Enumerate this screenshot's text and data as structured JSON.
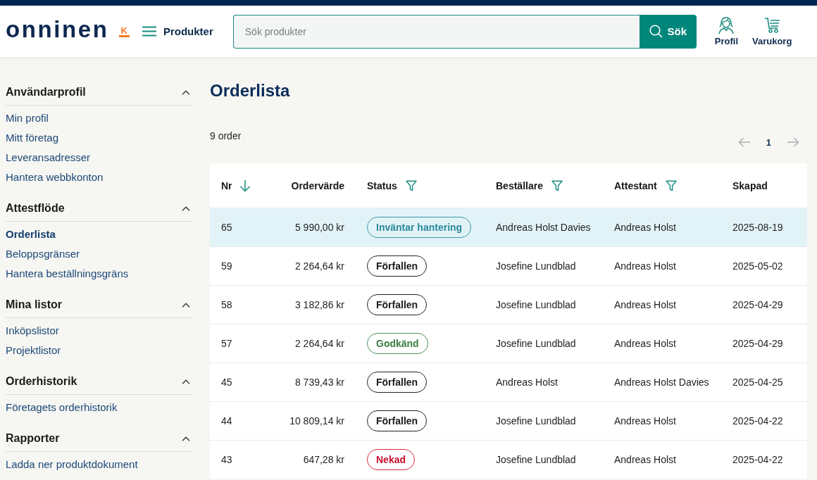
{
  "header": {
    "logo": {
      "wordmark": "onninen",
      "badge": "K"
    },
    "menu_button": {
      "label": "Produkter"
    },
    "search": {
      "placeholder": "Sök produkter",
      "button": "Sök"
    },
    "actions": [
      {
        "label": "Profil",
        "kind": "profile"
      },
      {
        "label": "Varukorg",
        "kind": "cart"
      }
    ]
  },
  "sidebar": {
    "sections": [
      {
        "title": "Användarprofil",
        "expanded": true,
        "items": [
          {
            "label": "Min profil",
            "selected": false
          },
          {
            "label": "Mitt företag",
            "selected": false
          },
          {
            "label": "Leveransadresser",
            "selected": false
          },
          {
            "label": "Hantera webbkonton",
            "selected": false
          }
        ]
      },
      {
        "title": "Attestflöde",
        "expanded": true,
        "items": [
          {
            "label": "Orderlista",
            "selected": true
          },
          {
            "label": "Beloppsgränser",
            "selected": false
          },
          {
            "label": "Hantera beställningsgräns",
            "selected": false
          }
        ]
      },
      {
        "title": "Mina listor",
        "expanded": true,
        "items": [
          {
            "label": "Inköpslistor",
            "selected": false
          },
          {
            "label": "Projektlistor",
            "selected": false
          }
        ]
      },
      {
        "title": "Orderhistorik",
        "expanded": true,
        "items": [
          {
            "label": "Företagets orderhistorik",
            "selected": false
          }
        ]
      },
      {
        "title": "Rapporter",
        "expanded": true,
        "items": [
          {
            "label": "Ladda ner produktdokument",
            "selected": false
          }
        ]
      }
    ]
  },
  "main": {
    "title": "Orderlista",
    "count": "9 order",
    "pagination": {
      "page": "1"
    },
    "table": {
      "columns": [
        {
          "label": "Nr",
          "sorted": true,
          "filter": false
        },
        {
          "label": "Ordervärde",
          "sorted": false,
          "filter": false
        },
        {
          "label": "Status",
          "sorted": false,
          "filter": true
        },
        {
          "label": "Beställare",
          "sorted": false,
          "filter": true
        },
        {
          "label": "Attestant",
          "sorted": false,
          "filter": true
        },
        {
          "label": "Skapad",
          "sorted": false,
          "filter": false
        }
      ],
      "rows": [
        {
          "nr": "65",
          "value": "5 990,00 kr",
          "status": {
            "label": "Inväntar hantering",
            "kind": "pending"
          },
          "orderer": "Andreas Holst Davies",
          "approver": "Andreas Holst",
          "created": "2025-08-19",
          "selected": true
        },
        {
          "nr": "59",
          "value": "2 264,64 kr",
          "status": {
            "label": "Förfallen",
            "kind": "overdue"
          },
          "orderer": "Josefine Lundblad",
          "approver": "Andreas Holst",
          "created": "2025-05-02",
          "selected": false
        },
        {
          "nr": "58",
          "value": "3 182,86 kr",
          "status": {
            "label": "Förfallen",
            "kind": "overdue"
          },
          "orderer": "Josefine Lundblad",
          "approver": "Andreas Holst",
          "created": "2025-04-29",
          "selected": false
        },
        {
          "nr": "57",
          "value": "2 264,64 kr",
          "status": {
            "label": "Godkänd",
            "kind": "approved"
          },
          "orderer": "Josefine Lundblad",
          "approver": "Andreas Holst",
          "created": "2025-04-29",
          "selected": false
        },
        {
          "nr": "45",
          "value": "8 739,43 kr",
          "status": {
            "label": "Förfallen",
            "kind": "overdue"
          },
          "orderer": "Andreas Holst",
          "approver": "Andreas Holst Davies",
          "created": "2025-04-25",
          "selected": false
        },
        {
          "nr": "44",
          "value": "10 809,14 kr",
          "status": {
            "label": "Förfallen",
            "kind": "overdue"
          },
          "orderer": "Josefine Lundblad",
          "approver": "Andreas Holst",
          "created": "2025-04-22",
          "selected": false
        },
        {
          "nr": "43",
          "value": "647,28 kr",
          "status": {
            "label": "Nekad",
            "kind": "rejected"
          },
          "orderer": "Josefine Lundblad",
          "approver": "Andreas Holst",
          "created": "2025-04-22",
          "selected": false
        }
      ]
    }
  }
}
